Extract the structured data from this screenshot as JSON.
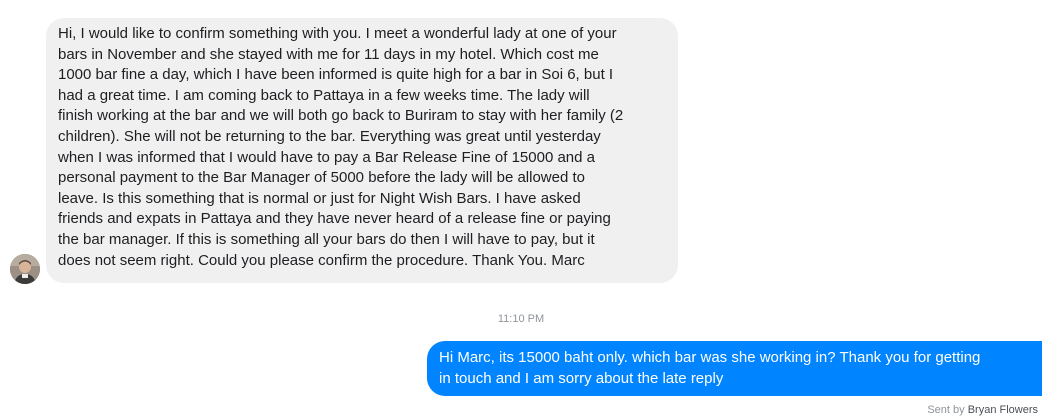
{
  "conversation": {
    "incoming_message": {
      "lines": [
        "Hi, I would like to confirm something with you. I meet a wonderful lady at one of your",
        "bars in November and she stayed with me for 11 days in my hotel.  Which cost me",
        "1000 bar fine a day, which I have been informed is quite high for a bar in Soi 6, but I",
        "had a great time.  I am coming back to Pattaya in a few weeks time. The lady will",
        "finish working at the bar and we will both go back to Buriram to stay with her family (2",
        "children).  She will not be returning to the bar.  Everything was great until yesterday",
        "when I was informed that I would have to pay a Bar Release Fine of 15000 and a",
        "personal payment to the Bar Manager of 5000 before the lady will be allowed to",
        "leave.  Is this something that is normal or just for Night Wish Bars.  I have asked",
        "friends and expats in Pattaya and they have never heard of a release fine or paying",
        "the bar manager.  If this is something all your bars do then I will have to pay, but it",
        "does not seem right.  Could you please confirm the procedure.  Thank You.  Marc"
      ]
    },
    "timestamp": "11:10 PM",
    "outgoing_message": {
      "lines": [
        "Hi Marc,   its 15000 baht only.  which bar was she working in? Thank you for getting",
        "in touch and I am sorry about the late reply"
      ]
    },
    "sent_by": {
      "prefix": "Sent by",
      "name": "Bryan Flowers"
    }
  },
  "colors": {
    "incoming_bubble": "#f1f0f0",
    "outgoing_bubble": "#0084ff",
    "meta_text": "#90949c"
  }
}
